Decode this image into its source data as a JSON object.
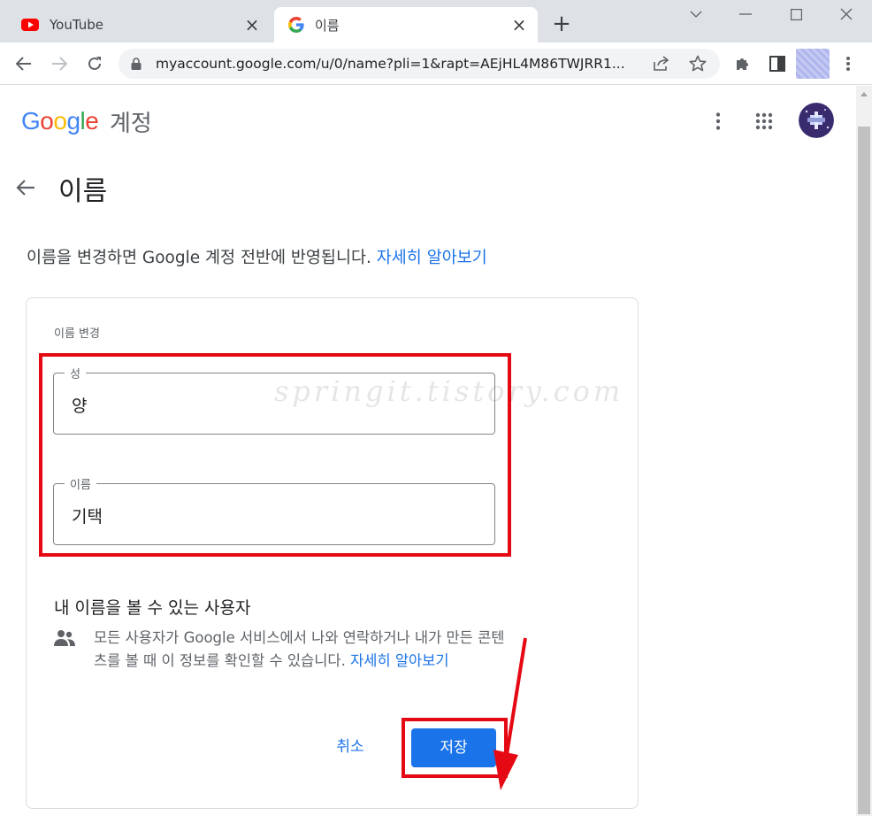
{
  "browser": {
    "tabs": [
      {
        "title": "YouTube",
        "icon": "youtube-icon",
        "active": false
      },
      {
        "title": "이름",
        "icon": "google-g-icon",
        "active": true
      }
    ],
    "url": "myaccount.google.com/u/0/name?pli=1&rapt=AEjHL4M86TWJRR1..."
  },
  "header": {
    "logo_letters": [
      "G",
      "o",
      "o",
      "g",
      "l",
      "e"
    ],
    "logo_colors": [
      "#4285F4",
      "#EA4335",
      "#FBBC05",
      "#4285F4",
      "#34A853",
      "#EA4335"
    ],
    "account_word": "계정"
  },
  "page": {
    "title": "이름",
    "description": "이름을 변경하면 Google 계정 전반에 반영됩니다.",
    "description_link": "자세히 알아보기"
  },
  "form": {
    "section_label": "이름 변경",
    "last_name": {
      "label": "성",
      "value": "양"
    },
    "first_name": {
      "label": "이름",
      "value": "기택"
    }
  },
  "visibility": {
    "title": "내 이름을 볼 수 있는 사용자",
    "text": "모든 사용자가 Google 서비스에서 나와 연락하거나 내가 만든 콘텐츠를 볼 때 이 정보를 확인할 수 있습니다.",
    "link": "자세히 알아보기",
    "icon": "people-icon"
  },
  "actions": {
    "cancel": "취소",
    "save": "저장"
  },
  "annotation": {
    "watermark": "springit.tistory.com",
    "highlight_color": "#e50914"
  },
  "colors": {
    "accent": "#1a73e8",
    "tab_strip": "#dee1e6"
  }
}
